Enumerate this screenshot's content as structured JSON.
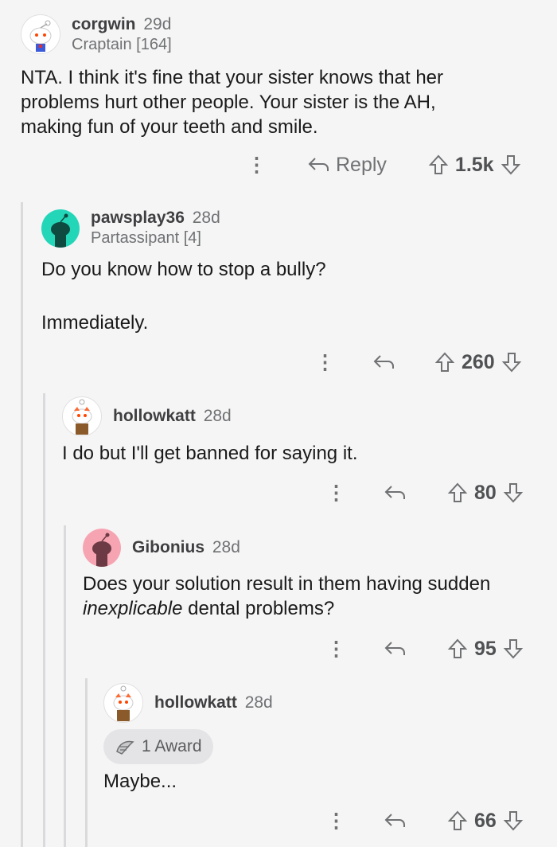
{
  "comments": [
    {
      "username": "corgwin",
      "age": "29d",
      "flair": "Craptain [164]",
      "body": [
        "NTA.  I think it's fine that your sister knows that her",
        "problems hurt other people.  Your sister is the AH,",
        "making fun of your teeth and smile."
      ],
      "reply_label": "Reply",
      "score": "1.5k",
      "avatar_color": "#ffffff"
    },
    {
      "username": "pawsplay36",
      "age": "28d",
      "flair": "Partassipant [4]",
      "body": [
        "Do you know how to stop a bully?",
        "",
        "Immediately."
      ],
      "score": "260",
      "avatar_color": "#24d6b8"
    },
    {
      "username": "hollowkatt",
      "age": "28d",
      "body": [
        "I do but I'll get banned for saying it."
      ],
      "score": "80",
      "avatar_color": "#ffffff"
    },
    {
      "username": "Gibonius",
      "age": "28d",
      "body_plain": "Does your solution result in them having sudden",
      "body_italic": "inexplicable",
      "body_after": " dental problems?",
      "score": "95",
      "avatar_color": "#f7a4b2"
    },
    {
      "username": "hollowkatt",
      "age": "28d",
      "award": "1 Award",
      "body": [
        "Maybe..."
      ],
      "score": "66",
      "avatar_color": "#ffffff"
    }
  ],
  "icons": {
    "more": "more-icon",
    "reply": "reply-arrow-icon",
    "upvote": "upvote-arrow-icon",
    "downvote": "downvote-arrow-icon"
  }
}
